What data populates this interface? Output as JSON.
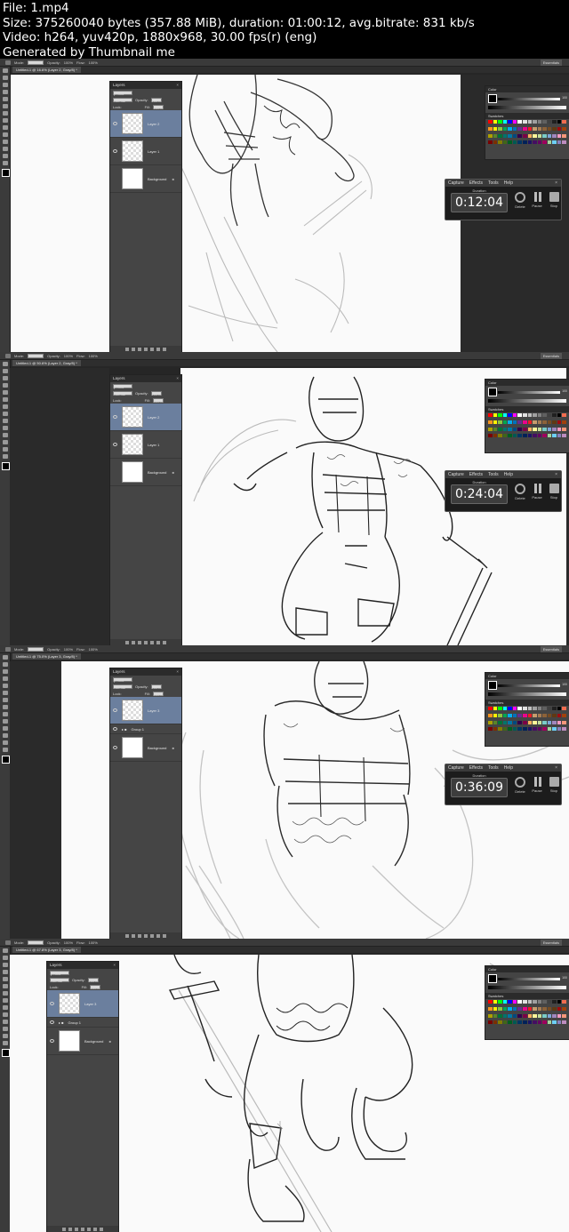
{
  "header": {
    "file": "File: 1.mp4",
    "size": "Size: 375260040 bytes (357.88 MiB), duration: 01:00:12, avg.bitrate: 831 kb/s",
    "video": "Video: h264, yuv420p, 1880x968, 30.00 fps(r) (eng)",
    "generated": "Generated by Thumbnail me"
  },
  "options_bar": {
    "mode_label": "Mode:",
    "mode_value": "Normal",
    "opacity_label": "Opacity:",
    "opacity_value": "100%",
    "flow_label": "Flow:",
    "flow_value": "100%",
    "workspace": "Essentials"
  },
  "frames": [
    {
      "tab": "Untitled-1 @ 16.6% (Layer 2, Gray/8) *",
      "layers": [
        "Layer 2",
        "Layer 1",
        "Background"
      ],
      "capture_time": "0:12:04"
    },
    {
      "tab": "Untitled-1 @ 50.6% (Layer 2, Gray/8) *",
      "layers": [
        "Layer 2",
        "Layer 1",
        "Background"
      ],
      "capture_time": "0:24:04"
    },
    {
      "tab": "Untitled-1 @ 75.0% (Layer 3, Gray/8) *",
      "layers": [
        "Layer 3",
        "Group 1",
        "Background"
      ],
      "capture_time": "0:36:09"
    },
    {
      "tab": "Untitled-1 @ 67.8% (Layer 3, Gray/8) *",
      "layers": [
        "Layer 3",
        "Group 1",
        "Background"
      ]
    }
  ],
  "layers_panel": {
    "title": "Layers",
    "kind": "ρ Kind",
    "blend": "Normal",
    "opacity_label": "Opacity:",
    "opacity": "100%",
    "lock_label": "Lock:",
    "fill_label": "Fill:",
    "fill": "100%"
  },
  "color_panel": {
    "title": "Color",
    "swatches_title": "Swatches",
    "k_label": "K",
    "value": "100"
  },
  "capture": {
    "menu": [
      "Capture",
      "Effects",
      "Tools",
      "Help"
    ],
    "duration_label": "Duration",
    "delete": "Delete",
    "pause": "Pause",
    "stop": "Stop"
  },
  "colors": {
    "selected_layer": "#6b7f9e",
    "app_bg": "#262626"
  }
}
